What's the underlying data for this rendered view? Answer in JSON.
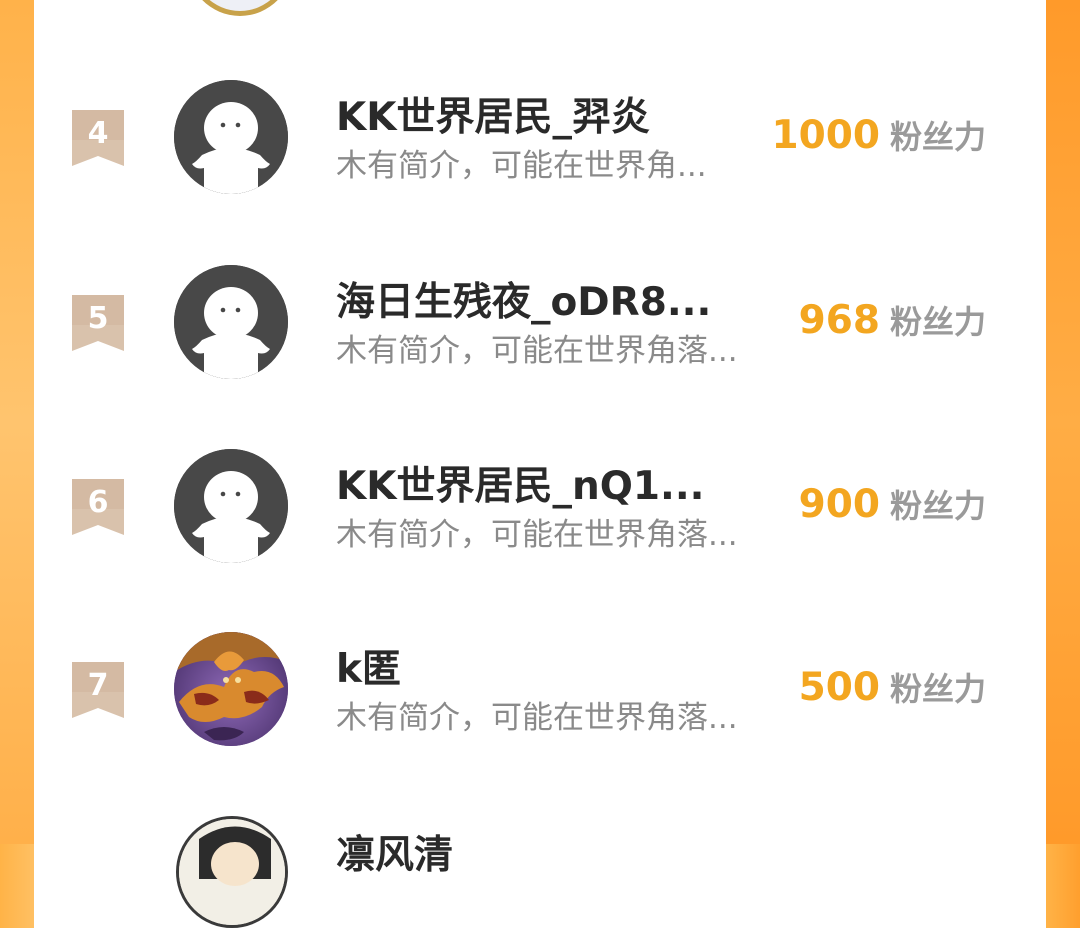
{
  "colors": {
    "accent": "#f3a620",
    "side_orange": "#ffa53a",
    "rank_badge": "#d6bfa8",
    "text_primary": "#2a2a2a",
    "text_secondary": "#8a8a8a"
  },
  "unit_label": "粉丝力",
  "rows": [
    {
      "rank": "4",
      "name": "KK世界居民_羿炎",
      "bio": "木有简介，可能在世界角...",
      "value": "1000",
      "unit": "粉丝力",
      "avatar": "default-avatar-icon"
    },
    {
      "rank": "5",
      "name": "海日生残夜_oDR8...",
      "bio": "木有简介，可能在世界角落...",
      "value": "968",
      "unit": "粉丝力",
      "avatar": "default-avatar-icon"
    },
    {
      "rank": "6",
      "name": "KK世界居民_nQ1...",
      "bio": "木有简介，可能在世界角落...",
      "value": "900",
      "unit": "粉丝力",
      "avatar": "default-avatar-icon"
    },
    {
      "rank": "7",
      "name": "k匿",
      "bio": "木有简介，可能在世界角落...",
      "value": "500",
      "unit": "粉丝力",
      "avatar": "fox-photo-avatar"
    }
  ],
  "partial_next": {
    "name": "凛风清"
  }
}
